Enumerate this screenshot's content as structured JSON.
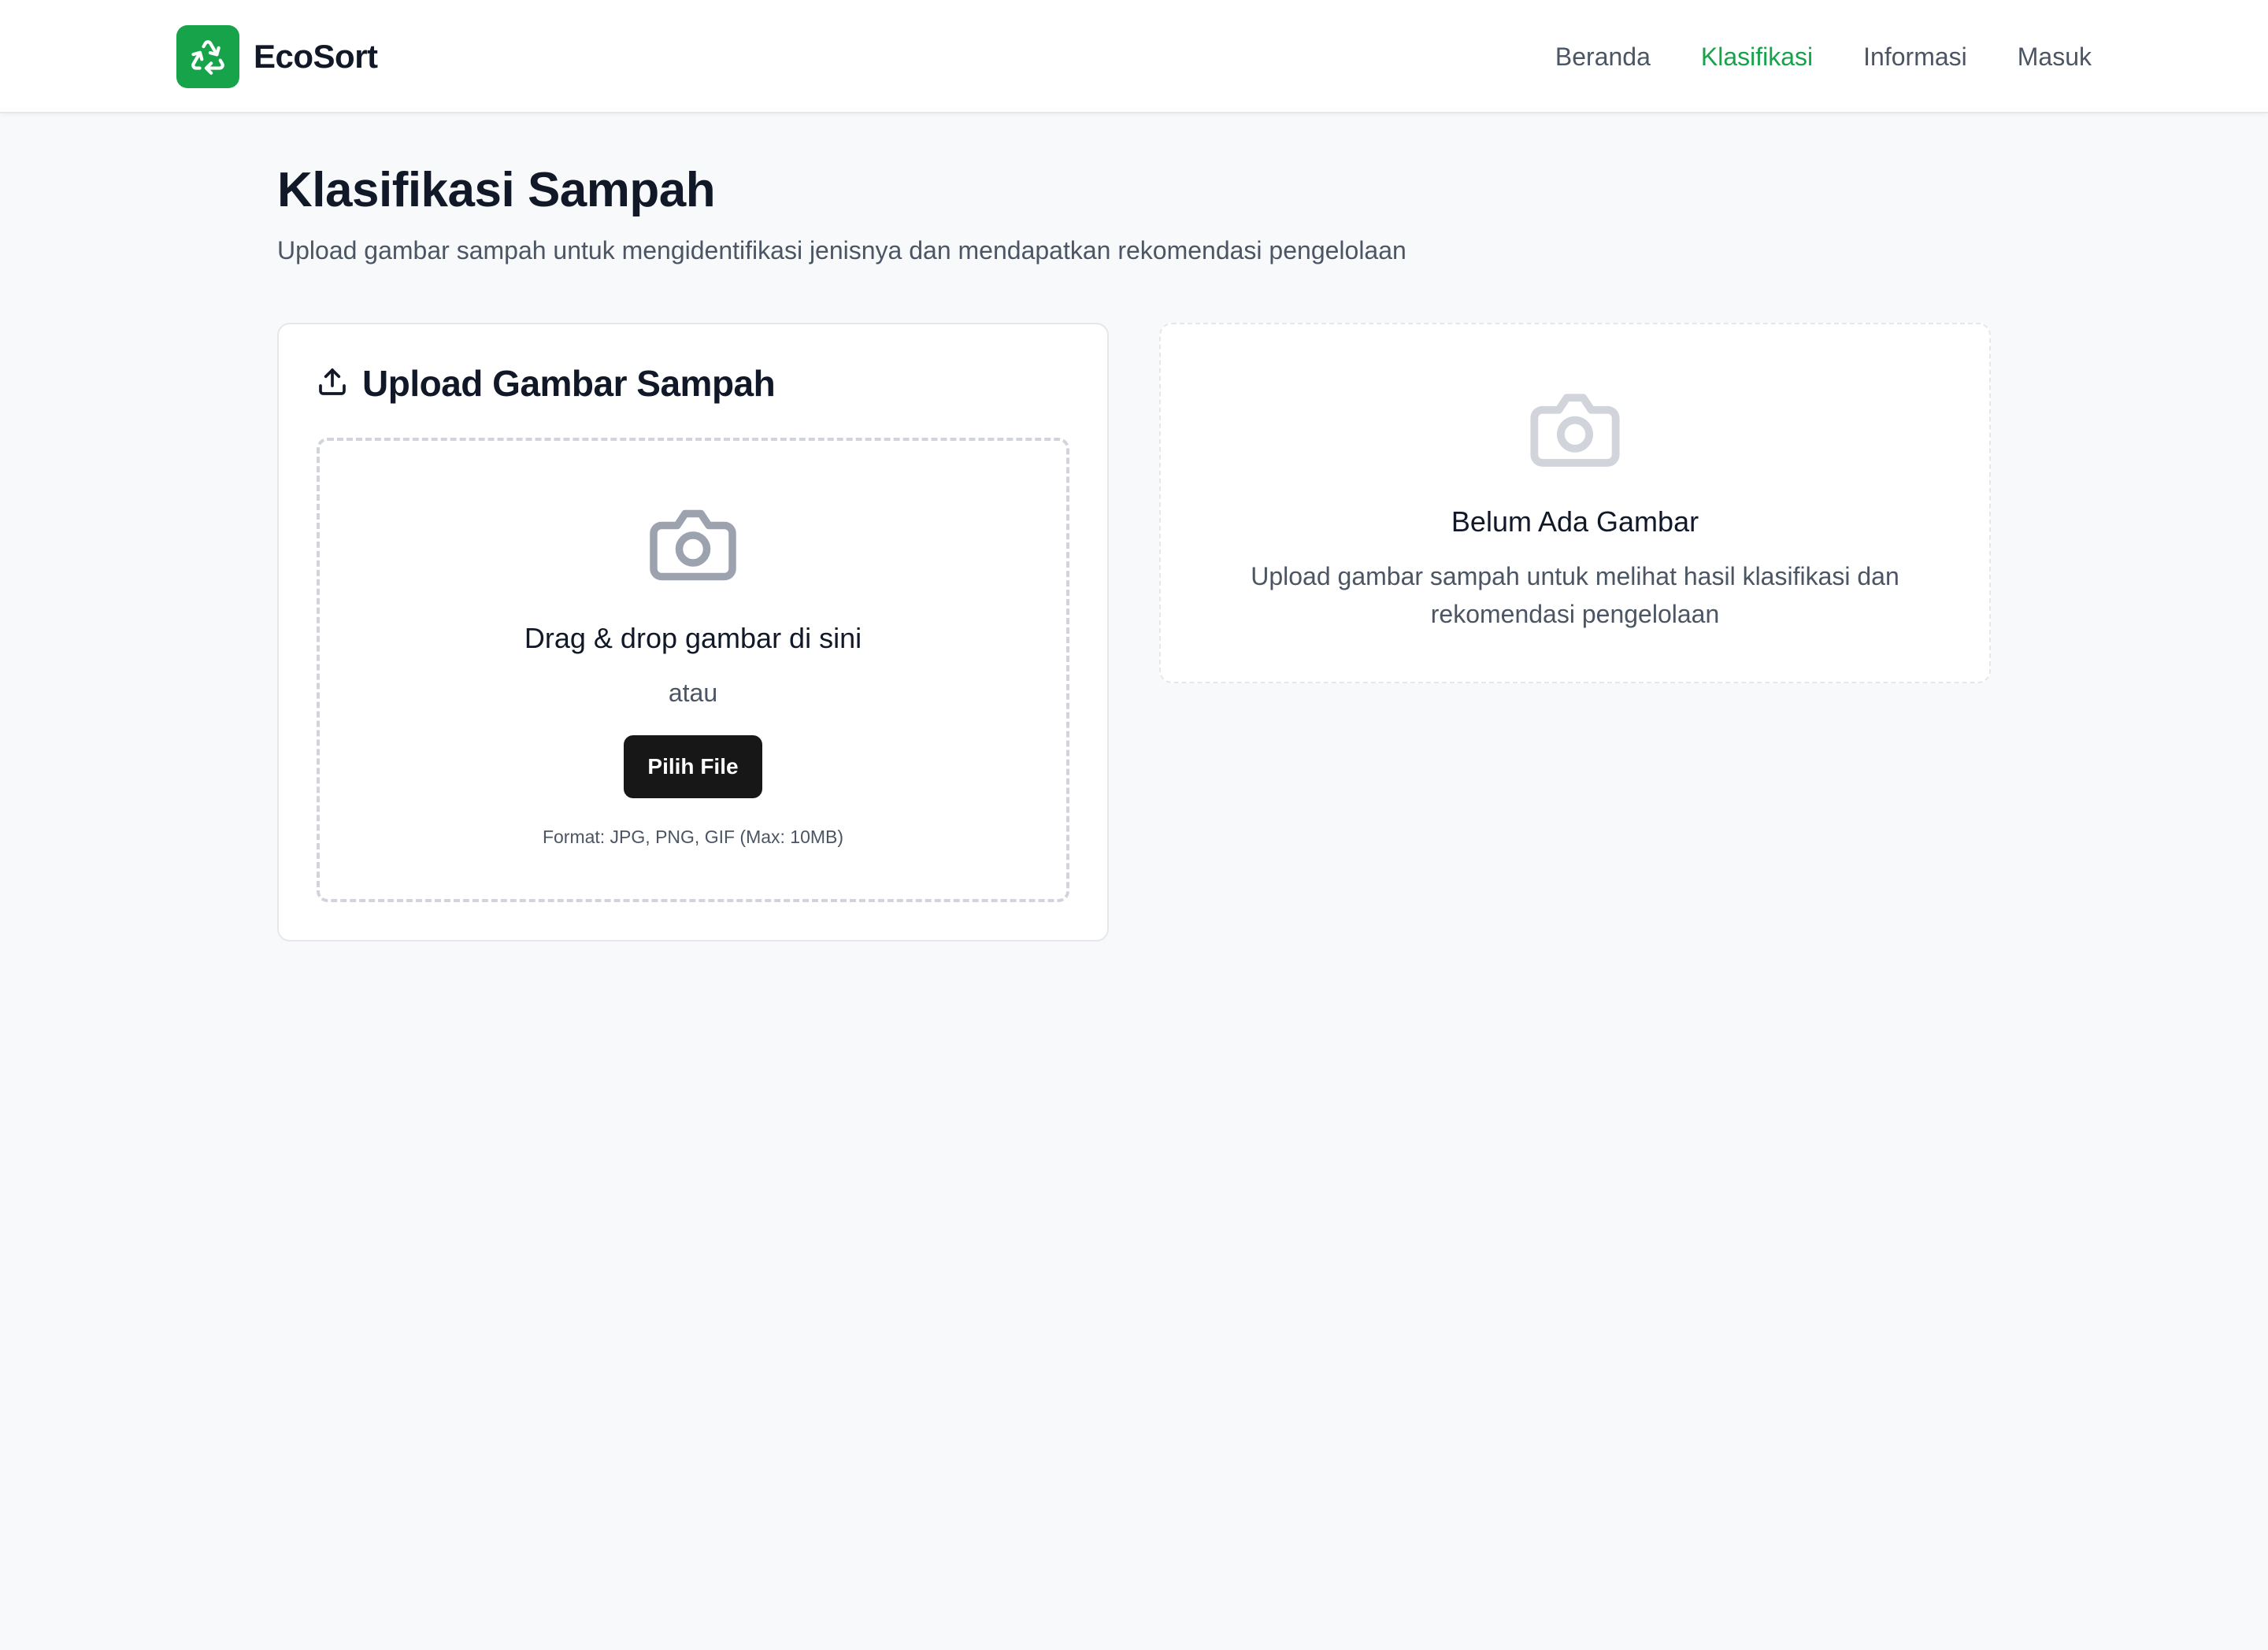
{
  "nav": {
    "brand": "EcoSort",
    "links": [
      {
        "label": "Beranda"
      },
      {
        "label": "Klasifikasi",
        "active": true
      },
      {
        "label": "Informasi"
      },
      {
        "label": "Masuk"
      }
    ]
  },
  "page": {
    "title": "Klasifikasi Sampah",
    "subtitle": "Upload gambar sampah untuk mengidentifikasi jenisnya dan mendapatkan rekomendasi pengelolaan"
  },
  "upload": {
    "title": "Upload Gambar Sampah",
    "drop_title": "Drag & drop gambar di sini",
    "or": "atau",
    "button_label": "Pilih File",
    "format_hint": "Format: JPG, PNG, GIF (Max: 10MB)"
  },
  "result": {
    "title": "Belum Ada Gambar",
    "description": "Upload gambar sampah untuk melihat hasil klasifikasi dan rekomendasi pengelolaan"
  },
  "icons": {
    "logo": "recycle-icon",
    "upload": "upload-icon",
    "camera": "camera-icon"
  },
  "colors": {
    "brand": "#16a34a",
    "active_nav": "#16a34a",
    "button_bg": "#171717",
    "background": "#f8f9fb",
    "camera_drop": "#9ca3af",
    "camera_empty": "#d1d5db"
  }
}
